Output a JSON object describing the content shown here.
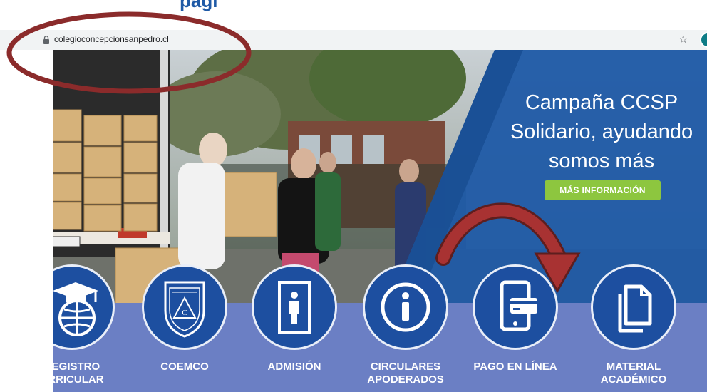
{
  "browser": {
    "url": "colegioconcepcionsanpedro.cl",
    "lock_icon": "lock-icon",
    "star_icon": "star-icon"
  },
  "colors": {
    "brand_blue": "#1d4fa0",
    "panel_blue": "#1f5aa6",
    "band": "#6b7fc4",
    "accent_green": "#8dc63f",
    "annotation_red": "#8b2b2b"
  },
  "hero": {
    "campaign_lines": [
      "Campaña CCSP",
      "Solidario, ayudando",
      "somos más"
    ],
    "more_button": "MÁS INFORMACIÓN"
  },
  "nav": [
    {
      "label_lines": [
        "REGISTRO",
        "URRICULAR"
      ],
      "icon": "graduation-globe-icon"
    },
    {
      "label_lines": [
        "COEMCO",
        ""
      ],
      "icon": "shield-crest-icon"
    },
    {
      "label_lines": [
        "ADMISIÓN",
        ""
      ],
      "icon": "door-person-icon"
    },
    {
      "label_lines": [
        "CIRCULARES",
        "APODERADOS"
      ],
      "icon": "info-icon"
    },
    {
      "label_lines": [
        "PAGO EN LÍNEA",
        ""
      ],
      "icon": "mobile-payment-icon"
    },
    {
      "label_lines": [
        "MATERIAL",
        "ACADÉMICO"
      ],
      "icon": "documents-icon"
    }
  ]
}
